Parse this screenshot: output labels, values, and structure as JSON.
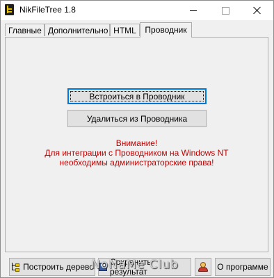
{
  "window": {
    "title": "NikFileTree 1.8"
  },
  "tabs": [
    {
      "label": "Главные",
      "active": false
    },
    {
      "label": "Дополнительно",
      "active": false
    },
    {
      "label": "HTML",
      "active": false
    },
    {
      "label": "Проводник",
      "active": true
    }
  ],
  "explorer_tab": {
    "integrate_label": "Встроиться в Проводник",
    "remove_label": "Удалиться из Проводника",
    "warning_lines": [
      "Внимание!",
      "Для интеграции с Проводником на Windows NT",
      "необходимы администраторские права!"
    ],
    "warning_color": "#c00000"
  },
  "bottom": {
    "build_label": "Построить дерево",
    "save_label": "Сохранить результат",
    "about_icon": "user-info-icon",
    "about_label": "О программе"
  },
  "watermark": "NoNaMe Club"
}
